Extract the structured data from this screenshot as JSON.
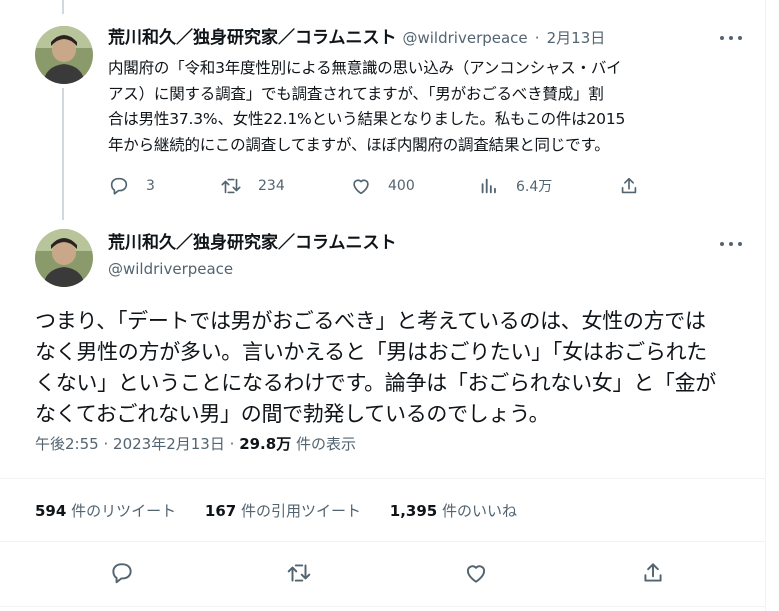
{
  "tweet1": {
    "author_name": "荒川和久／独身研究家／コラムニスト",
    "handle": "@wildriverpeace",
    "separator": "·",
    "date": "2月13日",
    "body": "内閣府の「令和3年度性別による無意識の思い込み（アンコンシャス・バイ\nアス）に関する調査」でも調査されてますが、「男がおごるべき賛成」割\n合は男性37.3%、女性22.1%という結果となりました。私もこの件は2015\n年から継続的にこの調査してますが、ほぼ内閣府の調査結果と同じです。",
    "replies": "3",
    "retweets": "234",
    "likes": "400",
    "views": "6.4万"
  },
  "tweet2": {
    "author_name": "荒川和久／独身研究家／コラムニスト",
    "handle": "@wildriverpeace",
    "body": "つまり、「デートでは男がおごるべき」と考えているのは、女性の方では\nなく男性の方が多い。言いかえると「男はおごりたい」「女はおごられた\nくない」ということになるわけです。論争は「おごられない女」と「金が\nなくておごれない男」の間で勃発しているのでしょう。",
    "time": "午後2:55",
    "time_sep": "·",
    "date": "2023年2月13日",
    "date_sep": "·",
    "views_count": "29.8万",
    "views_label": "件の表示",
    "retweet_count": "594",
    "retweet_label": "件のリツイート",
    "quote_count": "167",
    "quote_label": "件の引用ツイート",
    "like_count": "1,395",
    "like_label": "件のいいね"
  },
  "icons": {
    "reply": "reply-icon",
    "retweet": "retweet-icon",
    "like": "heart-icon",
    "views": "views-bar-chart-icon",
    "share": "share-icon",
    "more": "more-dots-icon"
  },
  "colors": {
    "text": "#0f1419",
    "secondary": "#536471",
    "divider": "#eff3f4",
    "thread_line": "#cfd9de"
  }
}
